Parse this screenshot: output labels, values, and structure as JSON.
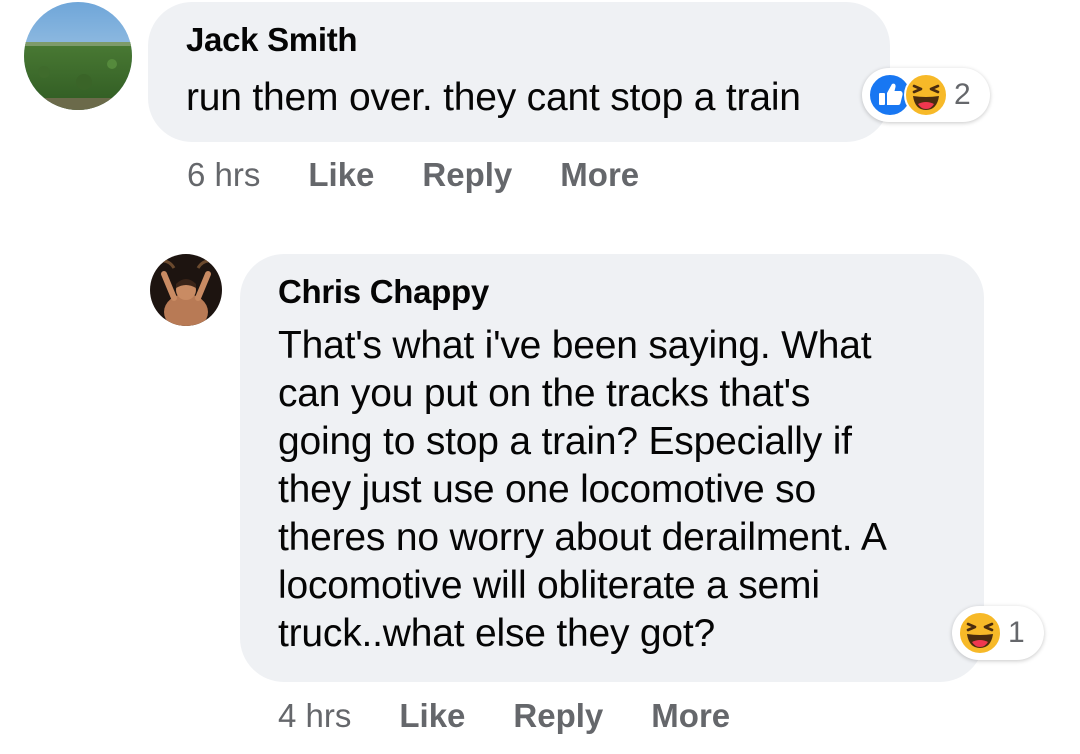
{
  "comments": [
    {
      "author": "Jack Smith",
      "text": "run them over. they cant stop a train",
      "reactions": {
        "icons": [
          "like-icon",
          "haha-icon"
        ],
        "count": "2"
      },
      "time": "6 hrs",
      "actions": {
        "like": "Like",
        "reply": "Reply",
        "more": "More"
      }
    },
    {
      "author": "Chris Chappy",
      "text": "That's what i've been saying. What\ncan you put on the tracks that's\ngoing to stop a train? Especially if\nthey just use one locomotive so\ntheres no worry about derailment. A\nlocomotive will obliterate a semi\ntruck..what else they got?",
      "reactions": {
        "icons": [
          "haha-icon"
        ],
        "count": "1"
      },
      "time": "4 hrs",
      "actions": {
        "like": "Like",
        "reply": "Reply",
        "more": "More"
      }
    }
  ],
  "colors": {
    "bubble": "#eff1f4",
    "secondary_text": "#65676b",
    "like_blue": "#1877f2",
    "haha_yellow": "#f7b928"
  }
}
